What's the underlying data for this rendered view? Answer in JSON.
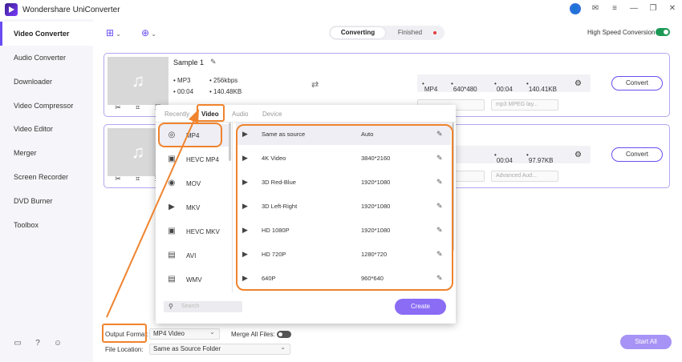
{
  "app": {
    "title": "Wondershare UniConverter"
  },
  "sidebar": {
    "items": [
      {
        "label": "Video Converter",
        "active": true
      },
      {
        "label": "Audio Converter"
      },
      {
        "label": "Downloader"
      },
      {
        "label": "Video Compressor"
      },
      {
        "label": "Video Editor"
      },
      {
        "label": "Merger"
      },
      {
        "label": "Screen Recorder"
      },
      {
        "label": "DVD Burner"
      },
      {
        "label": "Toolbox"
      }
    ]
  },
  "header": {
    "tabs": {
      "converting": "Converting",
      "finished": "Finished"
    },
    "high_speed_label": "High Speed Conversion"
  },
  "files": [
    {
      "title": "Sample 1",
      "src_format": "MP3",
      "src_bitrate": "256kbps",
      "src_duration": "00:04",
      "src_size": "140.48KB",
      "tgt_format": "MP4",
      "tgt_resolution": "640*480",
      "tgt_duration": "00:04",
      "tgt_size": "140.41KB",
      "sub_select_2": "mp3 MPEG lay...",
      "convert_label": "Convert"
    },
    {
      "tgt_duration": "00:04",
      "tgt_size": "97.97KB",
      "sub_select_2": "Advanced Aud...",
      "convert_label": "Convert"
    }
  ],
  "popup": {
    "tabs": [
      "Recently",
      "Video",
      "Audio",
      "Device"
    ],
    "active_tab": "Video",
    "formats": [
      "MP4",
      "HEVC MP4",
      "MOV",
      "MKV",
      "HEVC MKV",
      "AVI",
      "WMV"
    ],
    "selected_format": "MP4",
    "resolutions": [
      {
        "name": "Same as source",
        "value": "Auto"
      },
      {
        "name": "4K Video",
        "value": "3840*2160"
      },
      {
        "name": "3D Red-Blue",
        "value": "1920*1080"
      },
      {
        "name": "3D Left-Right",
        "value": "1920*1080"
      },
      {
        "name": "HD 1080P",
        "value": "1920*1080"
      },
      {
        "name": "HD 720P",
        "value": "1280*720"
      },
      {
        "name": "640P",
        "value": "960*640"
      }
    ],
    "search_placeholder": "Search",
    "create_label": "Create"
  },
  "footer": {
    "output_format_label": "Output Format:",
    "output_format_value": "MP4 Video",
    "merge_label": "Merge All Files:",
    "file_location_label": "File Location:",
    "file_location_value": "Same as Source Folder",
    "start_all_label": "Start All"
  },
  "colors": {
    "accent": "#6a4cf3",
    "annotation": "#f0832d",
    "toggle_on": "#1c9a55"
  }
}
